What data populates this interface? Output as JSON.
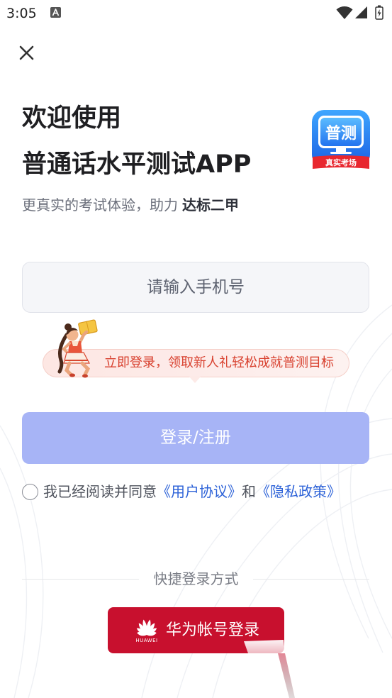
{
  "status_bar": {
    "time": "3:05",
    "icons": [
      "a-badge-icon",
      "wifi-icon",
      "signal-icon",
      "battery-charging-icon"
    ]
  },
  "close_button": {
    "icon": "close-icon"
  },
  "header": {
    "title_line1": "欢迎使用",
    "title_line2": "普通话水平测试APP",
    "subtitle_prefix": "更真实的考试体验，助力",
    "subtitle_highlight": "达标二甲"
  },
  "app_icon": {
    "name": "普测",
    "banner": "真实考场"
  },
  "phone_input": {
    "placeholder": "请输入手机号",
    "value": ""
  },
  "promo": {
    "text": "立即登录，领取新人礼轻松成就普测目标"
  },
  "login_button": {
    "label": "登录/注册"
  },
  "agreement": {
    "checked": false,
    "prefix": "我已经阅读并同意",
    "user_agreement": "《用户协议》",
    "conjunction": "和",
    "privacy_policy": "《隐私政策》"
  },
  "quick_login": {
    "title": "快捷登录方式"
  },
  "huawei_login": {
    "brand": "HUAWEI",
    "label": "华为帐号登录",
    "icon": "huawei-logo-icon"
  },
  "colors": {
    "title": "#1f1f22",
    "subtitle": "#6b6f7b",
    "login_button": "#a7b4f6",
    "link": "#2e63d8",
    "promo_text": "#d8402e",
    "promo_background": "#fde7e3",
    "huawei_red": "#c8102e"
  }
}
